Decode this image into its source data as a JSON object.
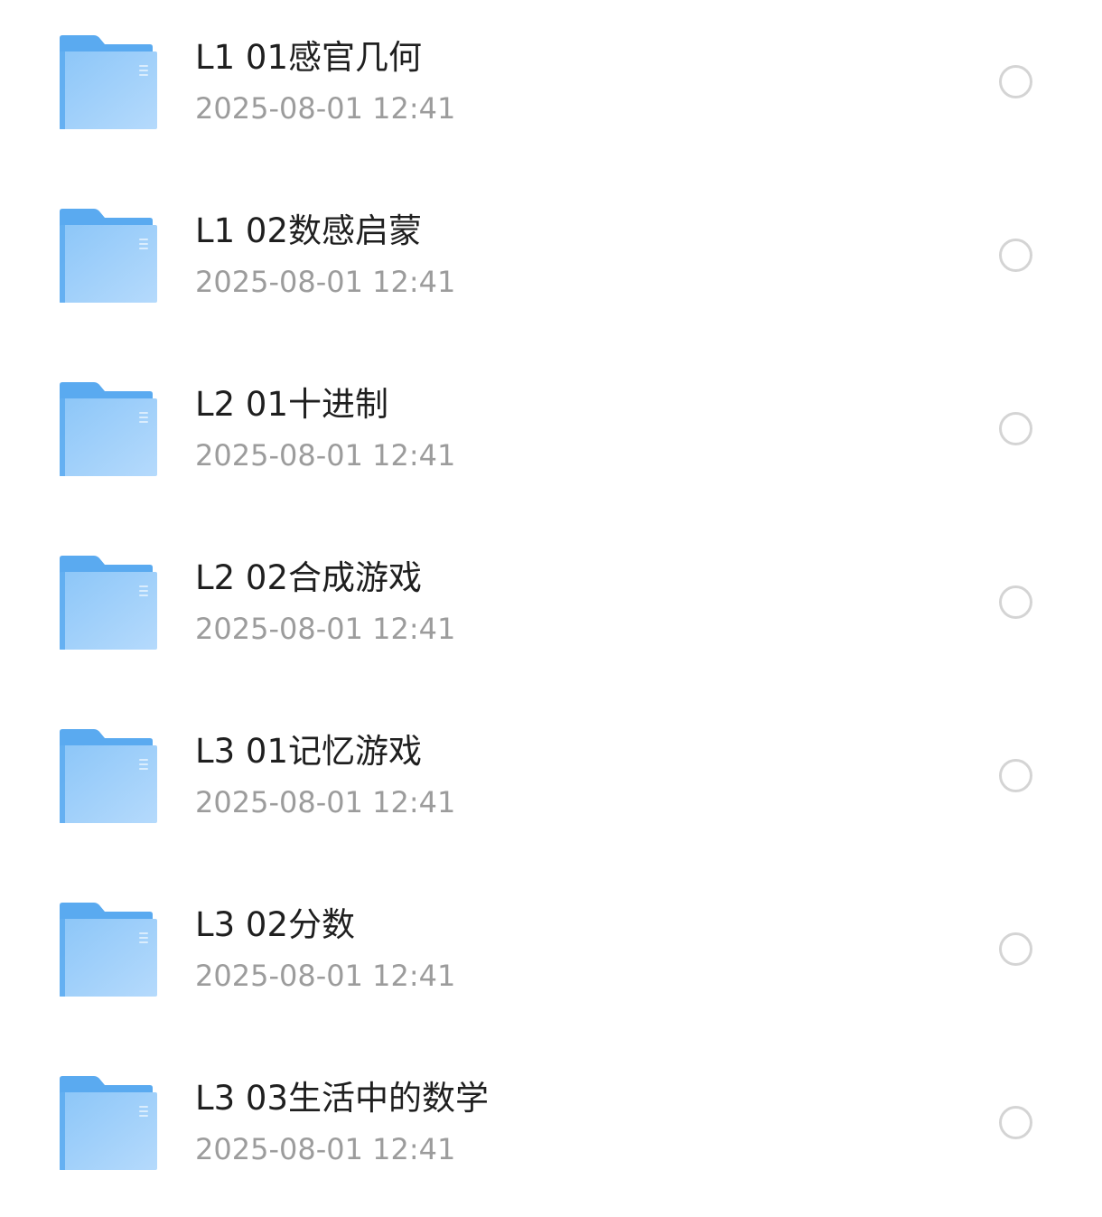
{
  "colors": {
    "folder_back": "#5aaaf0",
    "folder_front_light": "#b5dafc",
    "folder_front_dark": "#8cc6f8",
    "name_text": "#1f1f1f",
    "date_text": "#9c9c9c",
    "radio_border": "#d4d4d4"
  },
  "folders": [
    {
      "name": "L1 01感官几何",
      "date": "2025-08-01 12:41",
      "icon": "folder-icon",
      "selected": false
    },
    {
      "name": "L1 02数感启蒙",
      "date": "2025-08-01 12:41",
      "icon": "folder-icon",
      "selected": false
    },
    {
      "name": "L2 01十进制",
      "date": "2025-08-01 12:41",
      "icon": "folder-icon",
      "selected": false
    },
    {
      "name": "L2 02合成游戏",
      "date": "2025-08-01 12:41",
      "icon": "folder-icon",
      "selected": false
    },
    {
      "name": "L3 01记忆游戏",
      "date": "2025-08-01 12:41",
      "icon": "folder-icon",
      "selected": false
    },
    {
      "name": "L3 02分数",
      "date": "2025-08-01 12:41",
      "icon": "folder-icon",
      "selected": false
    },
    {
      "name": "L3 03生活中的数学",
      "date": "2025-08-01 12:41",
      "icon": "folder-icon",
      "selected": false
    }
  ]
}
